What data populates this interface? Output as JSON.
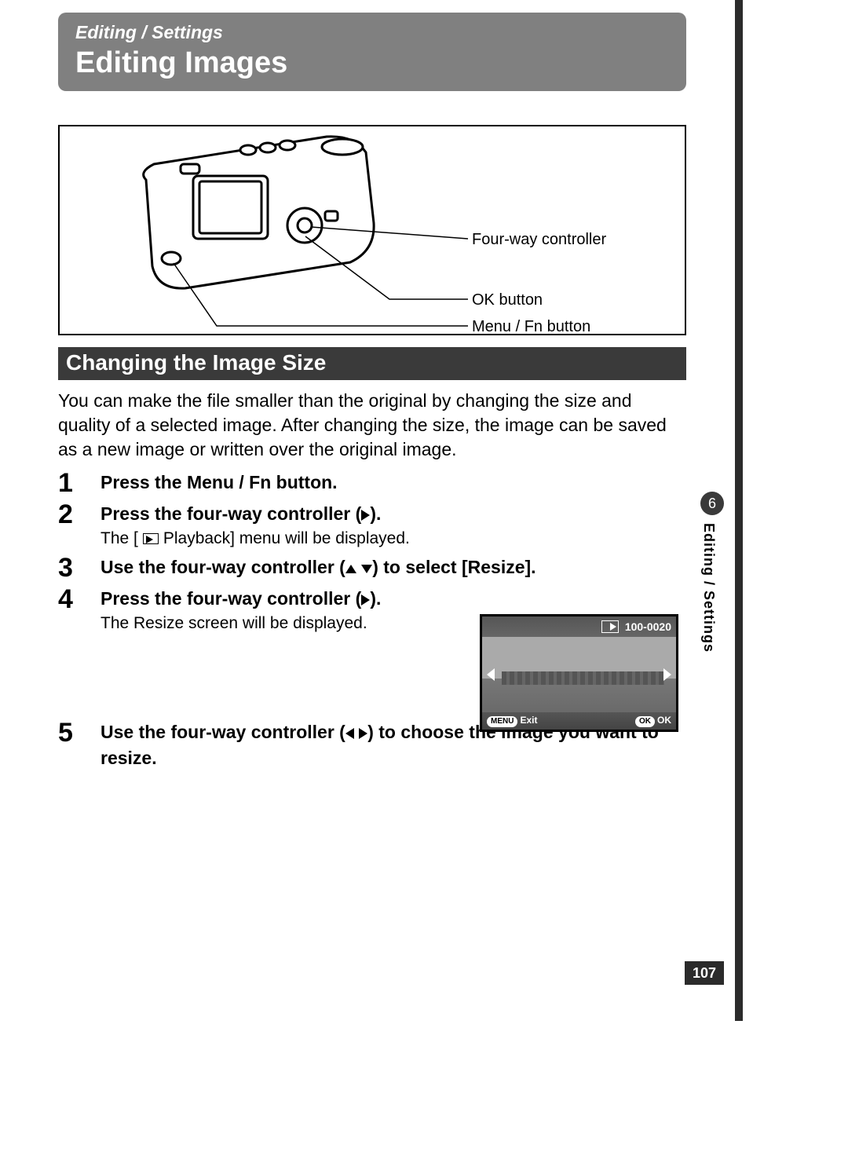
{
  "header": {
    "section": "Editing / Settings",
    "title": "Editing Images"
  },
  "diagram": {
    "callouts": [
      "Four-way controller",
      "OK button",
      "Menu / Fn button"
    ]
  },
  "subheader": "Changing the Image Size",
  "intro": "You can make the file smaller than the original by changing the size and quality of a selected image. After changing the size, the image can be saved as a new image or written over the original image.",
  "steps": [
    {
      "num": "1",
      "head_pre": "Press the Menu / Fn button.",
      "head_post": "",
      "arrows": []
    },
    {
      "num": "2",
      "head_pre": "Press the four-way controller (",
      "head_post": ").",
      "arrows": [
        "r"
      ],
      "sub_pre": "The [",
      "sub_icon": "pb",
      "sub_mid": " Playback] menu will be displayed.",
      "has_sub": true
    },
    {
      "num": "3",
      "head_pre": "Use the four-way controller (",
      "head_post": ") to select [Resize].",
      "arrows": [
        "u",
        "d"
      ]
    },
    {
      "num": "4",
      "head_pre": "Press the four-way controller (",
      "head_post": ").",
      "arrows": [
        "r"
      ],
      "sub_pre": "The Resize screen will be displayed.",
      "sub_icon": "",
      "sub_mid": "",
      "has_sub": true
    },
    {
      "num": "5",
      "head_pre": "Use the four-way controller (",
      "head_post": ") to choose the image you want to resize.",
      "arrows": [
        "l",
        "r"
      ]
    }
  ],
  "lcd": {
    "file_no": "100-0020",
    "menu_chip": "MENU",
    "menu_text": "Exit",
    "ok_chip": "OK",
    "ok_text": "OK"
  },
  "sidetab": {
    "num": "6",
    "label": "Editing / Settings"
  },
  "page_number": "107"
}
